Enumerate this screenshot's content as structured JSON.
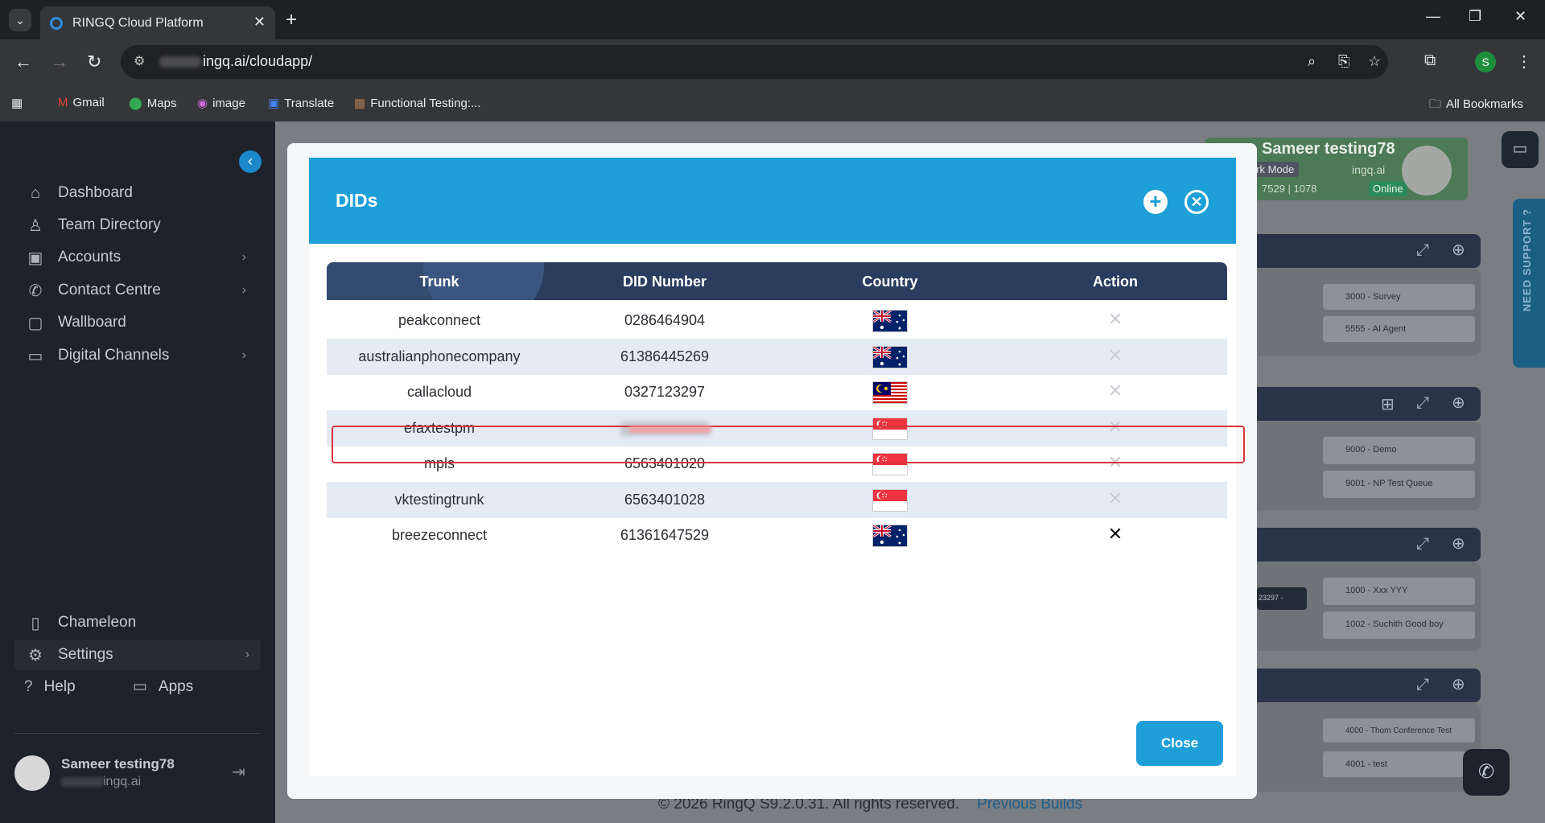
{
  "browser": {
    "tab_title": "RINGQ Cloud Platform",
    "url_suffix": "ingq.ai/cloudapp/",
    "bookmarks": [
      "Gmail",
      "Maps",
      "image",
      "Translate",
      "Functional Testing:..."
    ],
    "all_bookmarks": "All Bookmarks",
    "profile_initial": "S"
  },
  "sidebar": {
    "items": [
      {
        "label": "Dashboard",
        "icon": "home-icon"
      },
      {
        "label": "Team Directory",
        "icon": "person-icon"
      },
      {
        "label": "Accounts",
        "icon": "account-icon",
        "chevron": true
      },
      {
        "label": "Contact Centre",
        "icon": "phone-icon",
        "chevron": true
      },
      {
        "label": "Wallboard",
        "icon": "square-icon"
      },
      {
        "label": "Digital Channels",
        "icon": "chat-icon",
        "chevron": true
      }
    ],
    "lower_items": [
      {
        "label": "Chameleon",
        "icon": "clipboard-icon"
      },
      {
        "label": "Settings",
        "icon": "gear-icon",
        "chevron": true
      }
    ],
    "help": "Help",
    "apps": "Apps",
    "user_name": "Sameer testing78",
    "user_domain": "ingq.ai"
  },
  "background": {
    "user_card": {
      "name": "Sameer testing78",
      "dark_mode": "ark Mode",
      "domain": "ingq.ai",
      "ext_a": "7529",
      "ext_b": "1078",
      "status": "Online"
    },
    "support_tab": "NEED SUPPORT ?",
    "panel_items": [
      "3000 - Survey",
      "5555 - AI Agent",
      "9000 - Demo",
      "9001 - NP Test Queue",
      "1000 - Xxx YYY",
      "1002 - Suchith Good boy",
      "4000 - Thom Conference Test",
      "4001 - test"
    ],
    "chip": "23297 -",
    "footer": "© 2026 RingQ S9.2.0.31. All rights reserved.",
    "previous_builds": "Previous Builds"
  },
  "modal": {
    "title": "DIDs",
    "columns": [
      "Trunk",
      "DID Number",
      "Country",
      "Action"
    ],
    "rows": [
      {
        "trunk": "peakconnect",
        "did": "0286464904",
        "country": "AU"
      },
      {
        "trunk": "australianphonecompany",
        "did": "61386445269",
        "country": "AU"
      },
      {
        "trunk": "callacloud",
        "did": "0327123297",
        "country": "MY"
      },
      {
        "trunk": "efaxtestpm",
        "did": "",
        "country": "SG"
      },
      {
        "trunk": "mpls",
        "did": "6563401020",
        "country": "SG"
      },
      {
        "trunk": "vktestingtrunk",
        "did": "6563401028",
        "country": "SG"
      },
      {
        "trunk": "breezeconnect",
        "did": "61361647529",
        "country": "AU"
      }
    ],
    "close_label": "Close"
  },
  "colors": {
    "accent": "#1e9fd8",
    "header_dark": "#2b3d5e",
    "highlight": "#d9343d"
  }
}
